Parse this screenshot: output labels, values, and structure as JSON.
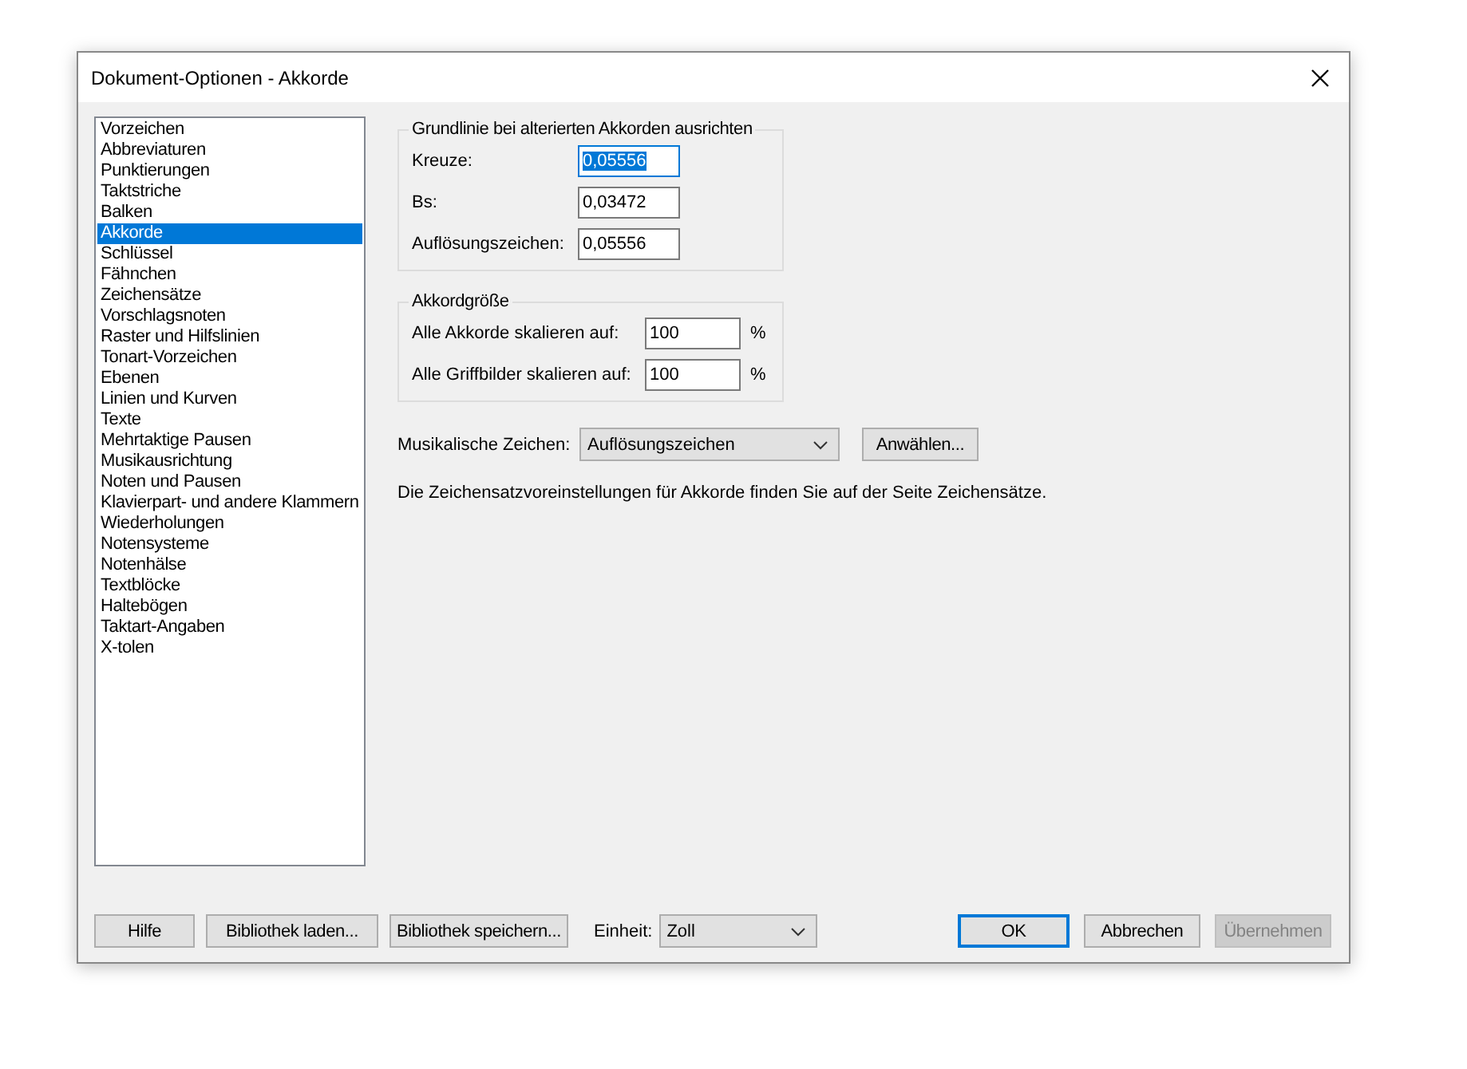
{
  "window": {
    "title": "Dokument-Optionen - Akkorde"
  },
  "sidebar": {
    "items": [
      {
        "label": "Vorzeichen",
        "selected": false
      },
      {
        "label": "Abbreviaturen",
        "selected": false
      },
      {
        "label": "Punktierungen",
        "selected": false
      },
      {
        "label": "Taktstriche",
        "selected": false
      },
      {
        "label": "Balken",
        "selected": false
      },
      {
        "label": "Akkorde",
        "selected": true
      },
      {
        "label": "Schlüssel",
        "selected": false
      },
      {
        "label": "Fähnchen",
        "selected": false
      },
      {
        "label": "Zeichensätze",
        "selected": false
      },
      {
        "label": "Vorschlagsnoten",
        "selected": false
      },
      {
        "label": "Raster und Hilfslinien",
        "selected": false
      },
      {
        "label": "Tonart-Vorzeichen",
        "selected": false
      },
      {
        "label": "Ebenen",
        "selected": false
      },
      {
        "label": "Linien und Kurven",
        "selected": false
      },
      {
        "label": "Texte",
        "selected": false
      },
      {
        "label": "Mehrtaktige Pausen",
        "selected": false
      },
      {
        "label": "Musikausrichtung",
        "selected": false
      },
      {
        "label": "Noten und Pausen",
        "selected": false
      },
      {
        "label": "Klavierpart- und andere Klammern",
        "selected": false
      },
      {
        "label": "Wiederholungen",
        "selected": false
      },
      {
        "label": "Notensysteme",
        "selected": false
      },
      {
        "label": "Notenhälse",
        "selected": false
      },
      {
        "label": "Textblöcke",
        "selected": false
      },
      {
        "label": "Haltebögen",
        "selected": false
      },
      {
        "label": "Taktart-Angaben",
        "selected": false
      },
      {
        "label": "X-tolen",
        "selected": false
      }
    ]
  },
  "baseline_group": {
    "title": "Grundlinie bei alterierten Akkorden ausrichten",
    "fields": [
      {
        "label": "Kreuze:",
        "value": "0,05556",
        "focused": true
      },
      {
        "label": "Bs:",
        "value": "0,03472",
        "focused": false
      },
      {
        "label": "Auflösungszeichen:",
        "value": "0,05556",
        "focused": false
      }
    ]
  },
  "size_group": {
    "title": "Akkordgröße",
    "fields": [
      {
        "label": "Alle Akkorde skalieren auf:",
        "value": "100",
        "unit": "%"
      },
      {
        "label": "Alle Griffbilder skalieren auf:",
        "value": "100",
        "unit": "%"
      }
    ]
  },
  "symbol_row": {
    "label": "Musikalische Zeichen:",
    "value": "Auflösungszeichen",
    "button": "Anwählen..."
  },
  "note": "Die Zeichensatzvoreinstellungen für Akkorde finden Sie auf der Seite Zeichensätze.",
  "footer": {
    "left_buttons": [
      "Hilfe",
      "Bibliothek laden...",
      "Bibliothek speichern..."
    ],
    "unit": {
      "label": "Einheit:",
      "value": "Zoll"
    },
    "right_buttons": [
      {
        "label": "OK",
        "default": true,
        "disabled": false
      },
      {
        "label": "Abbrechen",
        "default": false,
        "disabled": false
      },
      {
        "label": "Übernehmen",
        "default": false,
        "disabled": true
      }
    ]
  }
}
